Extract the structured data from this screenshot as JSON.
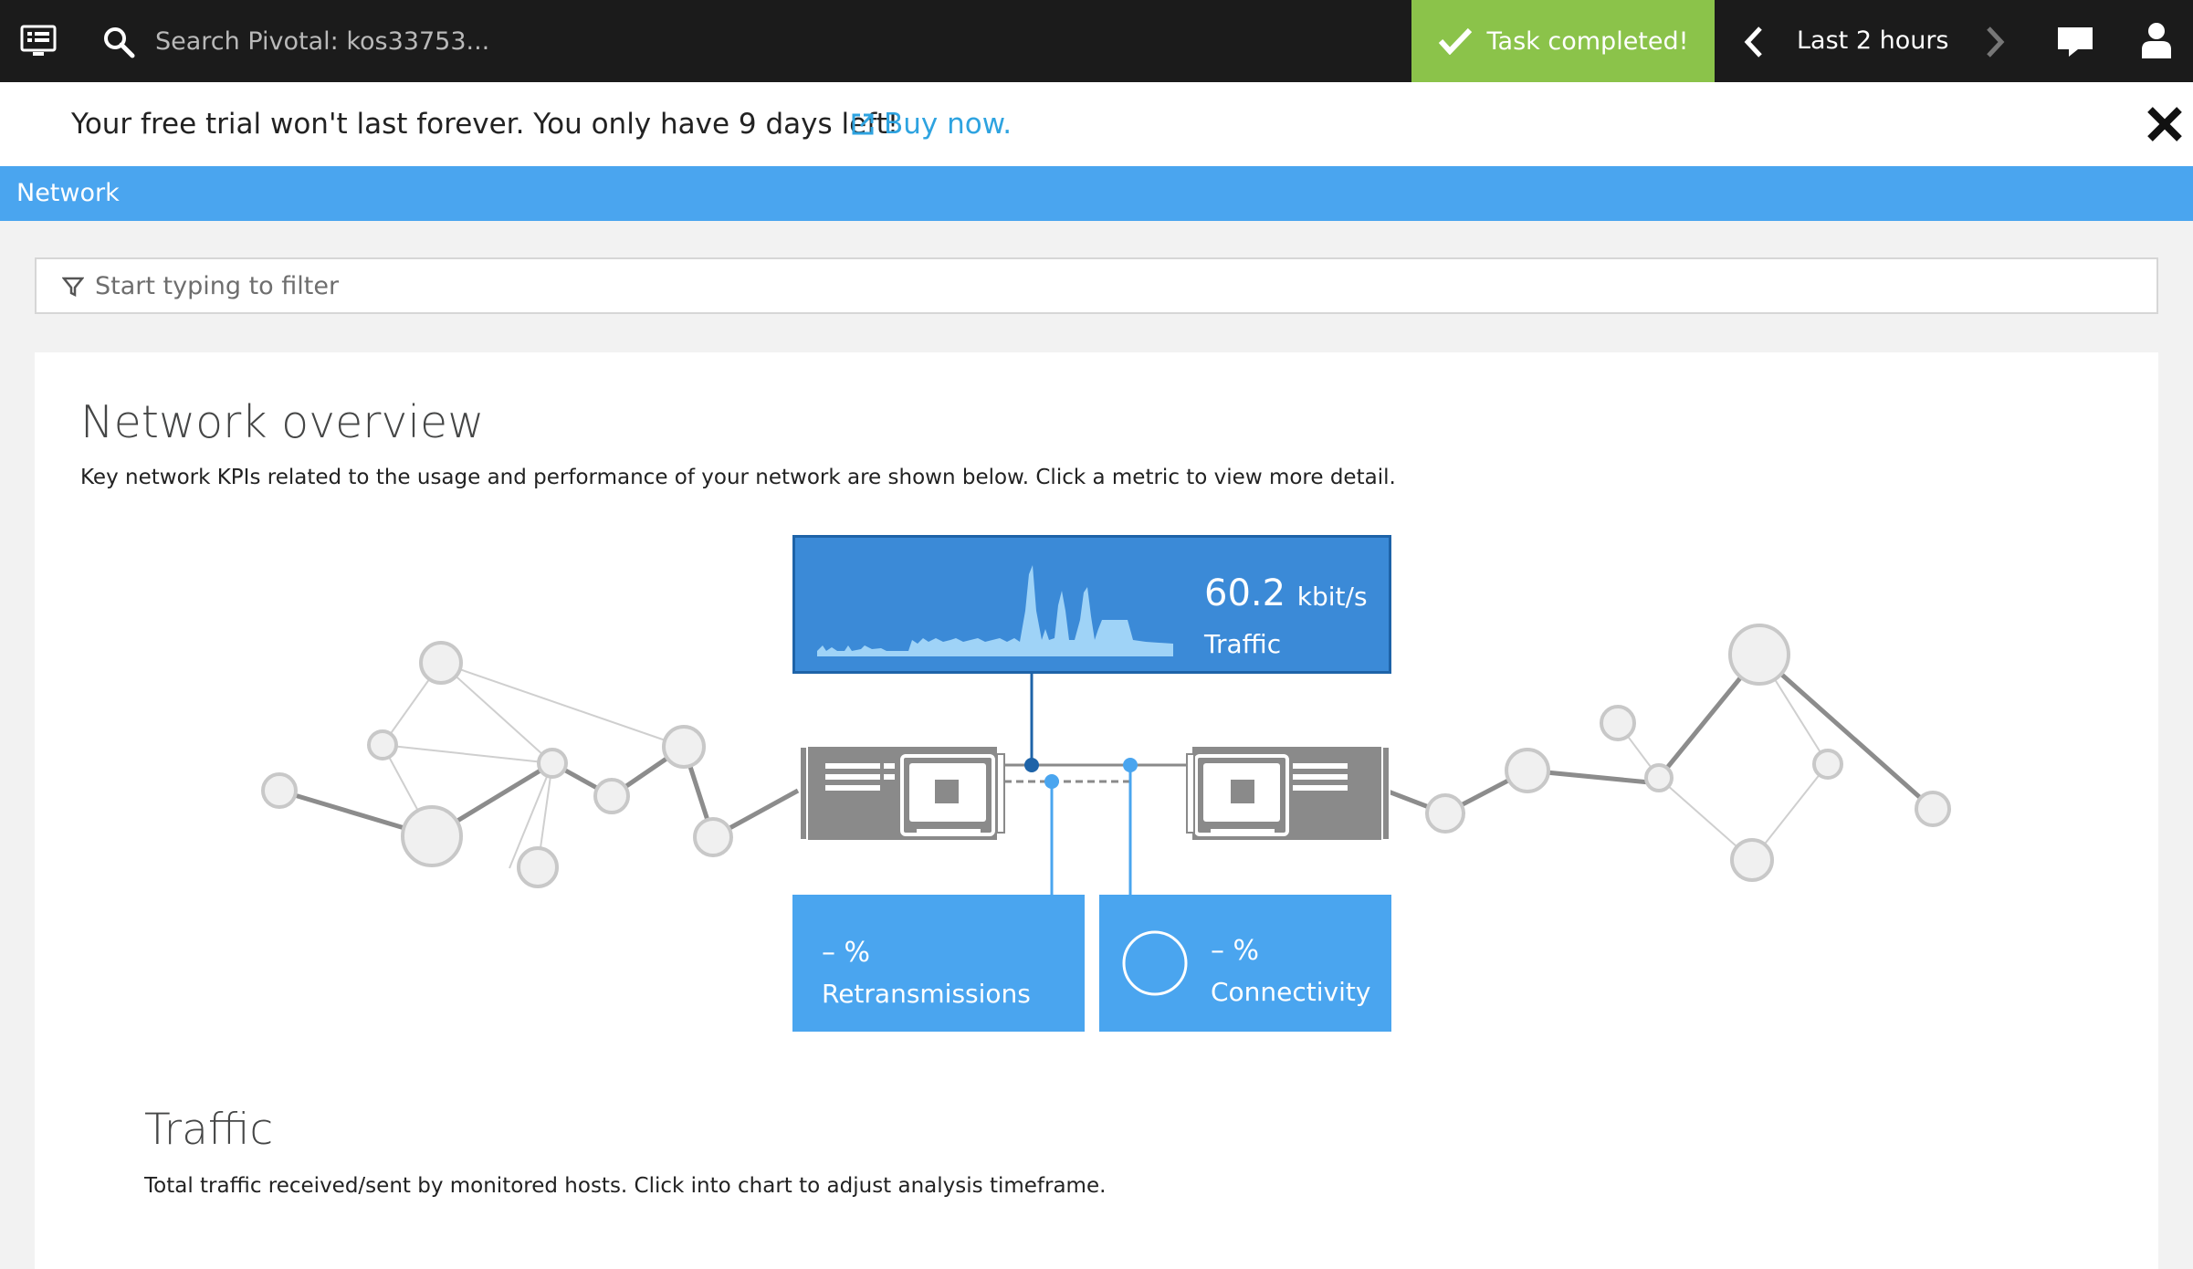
{
  "topbar": {
    "search_placeholder": "Search Pivotal: kos33753...",
    "task_status": "Task completed!",
    "timeframe": "Last 2 hours"
  },
  "banner": {
    "message": "Your free trial won't last forever. You only have 9 days left!",
    "link": "Buy now."
  },
  "section": {
    "title": "Network"
  },
  "filter": {
    "placeholder": "Start typing to filter"
  },
  "overview": {
    "title": "Network overview",
    "description": "Key network KPIs related to the usage and performance of your network are shown below. Click a metric to view more detail."
  },
  "kpis": {
    "traffic": {
      "value": "60.2",
      "unit": "kbit/s",
      "label": "Traffic"
    },
    "retransmissions": {
      "value": "– %",
      "label": "Retransmissions"
    },
    "connectivity": {
      "value": "– %",
      "label": "Connectivity"
    }
  },
  "traffic_section": {
    "title": "Traffic",
    "description": "Total traffic received/sent by monitored hosts. Click into chart to adjust analysis timeframe."
  },
  "colors": {
    "topbar": "#1b1b1b",
    "success": "#8bc34a",
    "section_header": "#4aa5ef",
    "traffic_tile": "#3b8ad7",
    "kpi_tile": "#4aa5ef",
    "link": "#2ea3e0"
  },
  "icons": [
    "menu-icon",
    "search-icon",
    "checkmark-icon",
    "chevron-left-icon",
    "chevron-right-icon",
    "chat-icon",
    "user-icon",
    "external-link-icon",
    "close-icon",
    "filter-icon"
  ]
}
